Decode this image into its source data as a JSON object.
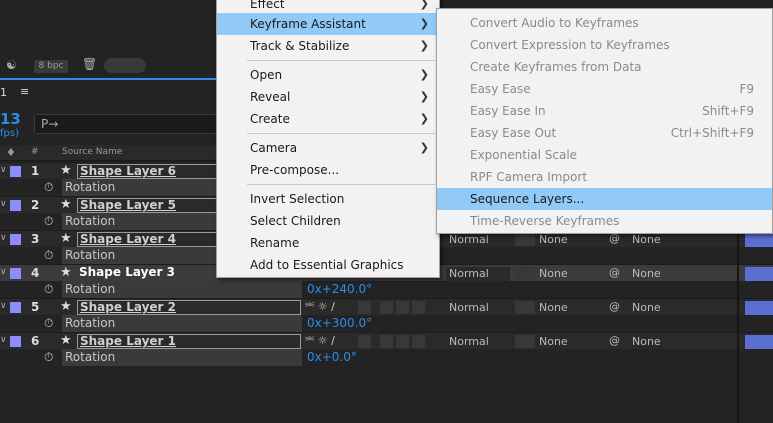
{
  "panel": {
    "bpc": "8 bpc",
    "comp_tab": "1",
    "timecode": "13",
    "fps": "fps)",
    "search_icon": "P→",
    "col_num": "#",
    "col_source": "Source Name"
  },
  "layers": [
    {
      "num": "1",
      "name": "Shape Layer 6",
      "prop": "Rotation",
      "value": ""
    },
    {
      "num": "2",
      "name": "Shape Layer 5",
      "prop": "Rotation",
      "value": ""
    },
    {
      "num": "3",
      "name": "Shape Layer 4",
      "prop": "Rotation",
      "value": "",
      "mode": "Normal",
      "track": "None",
      "parent": "None"
    },
    {
      "num": "4",
      "name": "Shape Layer 3",
      "prop": "Rotation",
      "value": "0x+240.0°",
      "mode": "Normal",
      "track": "None",
      "parent": "None"
    },
    {
      "num": "5",
      "name": "Shape Layer 2",
      "prop": "Rotation",
      "value": "0x+300.0°",
      "mode": "Normal",
      "track": "None",
      "parent": "None"
    },
    {
      "num": "6",
      "name": "Shape Layer 1",
      "prop": "Rotation",
      "value": "0x+0.0°",
      "mode": "Normal",
      "track": "None",
      "parent": "None"
    }
  ],
  "menu": {
    "items": [
      {
        "label": "Effect"
      },
      {
        "label": "Keyframe Assistant"
      },
      {
        "label": "Track & Stabilize"
      },
      {
        "label": "Open"
      },
      {
        "label": "Reveal"
      },
      {
        "label": "Create"
      },
      {
        "label": "Camera"
      },
      {
        "label": "Pre-compose..."
      },
      {
        "label": "Invert Selection"
      },
      {
        "label": "Select Children"
      },
      {
        "label": "Rename"
      },
      {
        "label": "Add to Essential Graphics"
      }
    ]
  },
  "submenu": {
    "items": [
      {
        "label": "Convert Audio to Keyframes",
        "shortcut": ""
      },
      {
        "label": "Convert Expression to Keyframes",
        "shortcut": ""
      },
      {
        "label": "Create Keyframes from Data",
        "shortcut": ""
      },
      {
        "label": "Easy Ease",
        "shortcut": "F9"
      },
      {
        "label": "Easy Ease In",
        "shortcut": "Shift+F9"
      },
      {
        "label": "Easy Ease Out",
        "shortcut": "Ctrl+Shift+F9"
      },
      {
        "label": "Exponential Scale",
        "shortcut": ""
      },
      {
        "label": "RPF Camera Import",
        "shortcut": ""
      },
      {
        "label": "Sequence Layers...",
        "shortcut": ""
      },
      {
        "label": "Time-Reverse Keyframes",
        "shortcut": ""
      }
    ]
  },
  "colors": {
    "accent": "#2d8ceb",
    "highlight": "#91c9f7",
    "layer_label": "#8c8cff"
  }
}
